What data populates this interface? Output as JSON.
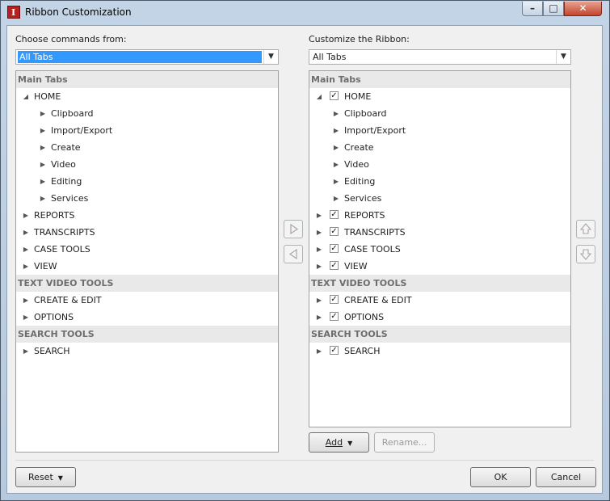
{
  "window": {
    "title": "Ribbon Customization"
  },
  "left": {
    "label": "Choose commands from:",
    "combo_value": "All Tabs",
    "rows": [
      {
        "kind": "group",
        "text": "Main Tabs"
      },
      {
        "kind": "item",
        "level": 0,
        "expand": "open",
        "text": "HOME"
      },
      {
        "kind": "item",
        "level": 1,
        "expand": "closed",
        "text": "Clipboard"
      },
      {
        "kind": "item",
        "level": 1,
        "expand": "closed",
        "text": "Import/Export"
      },
      {
        "kind": "item",
        "level": 1,
        "expand": "closed",
        "text": "Create"
      },
      {
        "kind": "item",
        "level": 1,
        "expand": "closed",
        "text": "Video"
      },
      {
        "kind": "item",
        "level": 1,
        "expand": "closed",
        "text": "Editing"
      },
      {
        "kind": "item",
        "level": 1,
        "expand": "closed",
        "text": "Services"
      },
      {
        "kind": "item",
        "level": 0,
        "expand": "closed",
        "text": "REPORTS"
      },
      {
        "kind": "item",
        "level": 0,
        "expand": "closed",
        "text": "TRANSCRIPTS"
      },
      {
        "kind": "item",
        "level": 0,
        "expand": "closed",
        "text": "CASE TOOLS"
      },
      {
        "kind": "item",
        "level": 0,
        "expand": "closed",
        "text": "VIEW"
      },
      {
        "kind": "group",
        "text": "TEXT VIDEO TOOLS"
      },
      {
        "kind": "item",
        "level": 0,
        "expand": "closed",
        "text": "CREATE & EDIT"
      },
      {
        "kind": "item",
        "level": 0,
        "expand": "closed",
        "text": "OPTIONS"
      },
      {
        "kind": "group",
        "text": "SEARCH TOOLS"
      },
      {
        "kind": "item",
        "level": 0,
        "expand": "closed",
        "text": "SEARCH"
      }
    ]
  },
  "right": {
    "label": "Customize the Ribbon:",
    "combo_value": "All Tabs",
    "rows": [
      {
        "kind": "group",
        "text": "Main Tabs"
      },
      {
        "kind": "item",
        "level": 0,
        "expand": "open",
        "checked": true,
        "text": "HOME"
      },
      {
        "kind": "item",
        "level": 1,
        "expand": "closed",
        "text": "Clipboard"
      },
      {
        "kind": "item",
        "level": 1,
        "expand": "closed",
        "text": "Import/Export"
      },
      {
        "kind": "item",
        "level": 1,
        "expand": "closed",
        "text": "Create"
      },
      {
        "kind": "item",
        "level": 1,
        "expand": "closed",
        "text": "Video"
      },
      {
        "kind": "item",
        "level": 1,
        "expand": "closed",
        "text": "Editing"
      },
      {
        "kind": "item",
        "level": 1,
        "expand": "closed",
        "text": "Services"
      },
      {
        "kind": "item",
        "level": 0,
        "expand": "closed",
        "checked": true,
        "text": "REPORTS"
      },
      {
        "kind": "item",
        "level": 0,
        "expand": "closed",
        "checked": true,
        "text": "TRANSCRIPTS"
      },
      {
        "kind": "item",
        "level": 0,
        "expand": "closed",
        "checked": true,
        "text": "CASE TOOLS"
      },
      {
        "kind": "item",
        "level": 0,
        "expand": "closed",
        "checked": true,
        "text": "VIEW"
      },
      {
        "kind": "group",
        "text": "TEXT VIDEO TOOLS"
      },
      {
        "kind": "item",
        "level": 0,
        "expand": "closed",
        "checked": true,
        "text": "CREATE & EDIT"
      },
      {
        "kind": "item",
        "level": 0,
        "expand": "closed",
        "checked": true,
        "text": "OPTIONS"
      },
      {
        "kind": "group",
        "text": "SEARCH TOOLS"
      },
      {
        "kind": "item",
        "level": 0,
        "expand": "closed",
        "checked": true,
        "text": "SEARCH"
      }
    ]
  },
  "buttons": {
    "add": "Add",
    "rename": "Rename...",
    "reset": "Reset",
    "ok": "OK",
    "cancel": "Cancel"
  },
  "icons": {
    "app": "app-icon",
    "minimize": "minimize-icon",
    "maximize": "maximize-icon",
    "close": "close-icon",
    "move_right": "arrow-right-icon",
    "move_left": "arrow-left-icon",
    "move_up": "arrow-up-icon",
    "move_down": "arrow-down-icon"
  },
  "colors": {
    "selection": "#3399ff",
    "group_bg": "#e9e9e9",
    "group_text": "#6d6d6d"
  }
}
